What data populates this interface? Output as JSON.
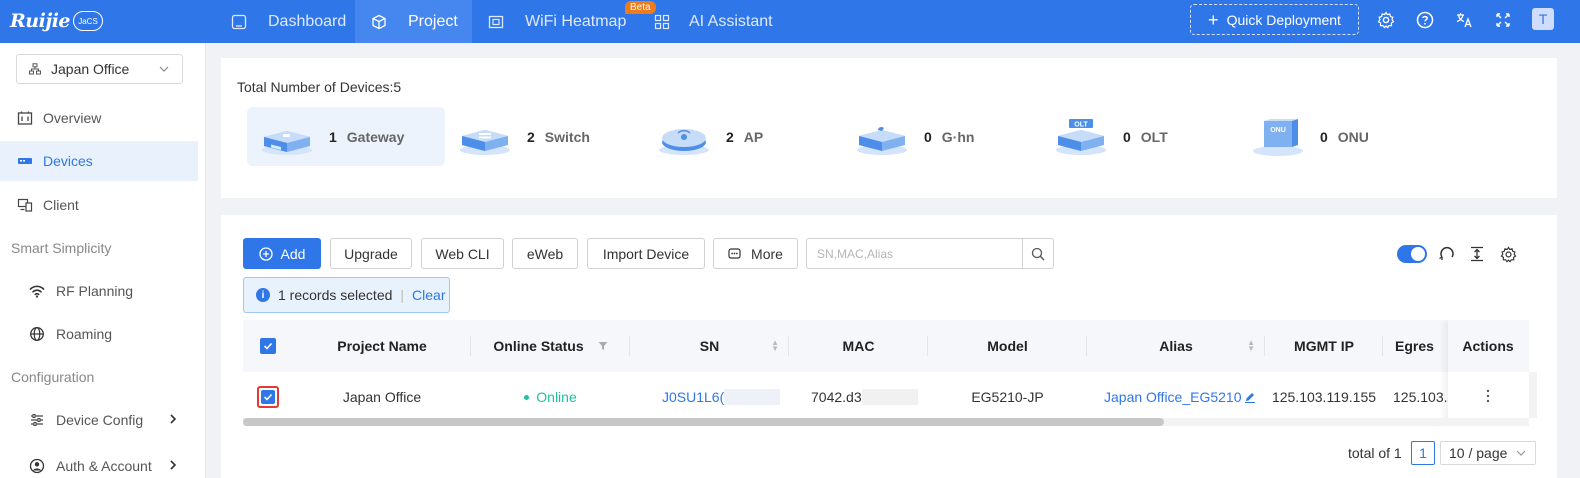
{
  "brand": {
    "name": "Ruijie",
    "badge": "JaCS"
  },
  "nav": {
    "items": [
      {
        "label": "Dashboard",
        "icon": "dashboard-icon"
      },
      {
        "label": "Project",
        "icon": "cube-icon",
        "active": true
      },
      {
        "label": "WiFi Heatmap",
        "icon": "heatmap-icon",
        "badge": "Beta"
      },
      {
        "label": "AI Assistant",
        "icon": "grid-icon"
      }
    ],
    "quick_deployment": "Quick Deployment",
    "avatar": "T"
  },
  "sidebar": {
    "project": "Japan Office",
    "items": [
      {
        "label": "Overview"
      },
      {
        "label": "Devices",
        "active": true
      },
      {
        "label": "Client"
      }
    ],
    "group1": "Smart Simplicity",
    "group1_items": [
      {
        "label": "RF Planning"
      },
      {
        "label": "Roaming"
      }
    ],
    "group2": "Configuration",
    "group2_items": [
      {
        "label": "Device Config"
      },
      {
        "label": "Auth & Account"
      }
    ]
  },
  "summary": {
    "title": "Total Number of Devices:5",
    "types": [
      {
        "count": "1",
        "label": "Gateway",
        "selected": true
      },
      {
        "count": "2",
        "label": "Switch"
      },
      {
        "count": "2",
        "label": "AP"
      },
      {
        "count": "0",
        "label": "G·hn"
      },
      {
        "count": "0",
        "label": "OLT"
      },
      {
        "count": "0",
        "label": "ONU"
      }
    ]
  },
  "toolbar": {
    "add": "Add",
    "upgrade": "Upgrade",
    "web_cli": "Web CLI",
    "eweb": "eWeb",
    "import": "Import Device",
    "more": "More",
    "search_placeholder": "SN,MAC,Alias"
  },
  "selection": {
    "text": "1 records selected",
    "clear": "Clear"
  },
  "table": {
    "columns": [
      "Project Name",
      "Online Status",
      "SN",
      "MAC",
      "Model",
      "Alias",
      "MGMT IP",
      "Egres",
      "Actions"
    ],
    "rows": [
      {
        "project": "Japan Office",
        "status": "Online",
        "sn": "J0SU1L6(",
        "mac": "7042.d3",
        "model": "EG5210-JP",
        "alias": "Japan Office_EG5210",
        "mgmt_ip": "125.103.119.155",
        "egress": "125.103.1"
      }
    ]
  },
  "pagination": {
    "total": "total of 1",
    "page": "1",
    "page_size": "10 / page"
  },
  "colors": {
    "primary": "#2f77e8",
    "online": "#1ec0a0",
    "beta": "#f07b1d"
  }
}
